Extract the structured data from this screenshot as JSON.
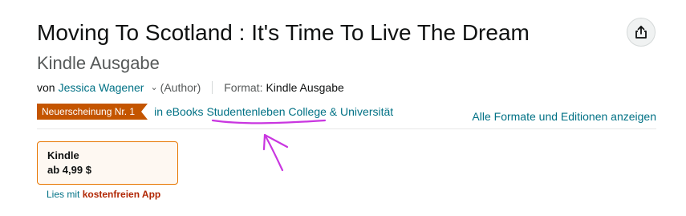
{
  "product": {
    "title": "Moving To Scotland : It's Time To Live The Dream",
    "subtitle": "Kindle Ausgabe",
    "byline": {
      "prefix": "von",
      "author": "Jessica Wagener",
      "role": "(Author)",
      "format_label": "Format:",
      "format_value": "Kindle Ausgabe"
    },
    "badge": {
      "label": "Neuerscheinung Nr. 1",
      "category": "in eBooks Studentenleben College & Universität"
    },
    "all_formats_link": "Alle Formate und Editionen anzeigen",
    "swatch": {
      "format": "Kindle",
      "price": "ab 4,99 $"
    },
    "read_app": {
      "prefix": "Lies mit",
      "app": "kostenfreien App"
    }
  },
  "icons": {
    "share": "share-icon",
    "author_dropdown": "chevron-down-icon"
  },
  "colors": {
    "link": "#007185",
    "badge": "#c45500",
    "swatch_border": "#e77600",
    "price_red": "#b12704",
    "annotation": "#c936e0"
  }
}
